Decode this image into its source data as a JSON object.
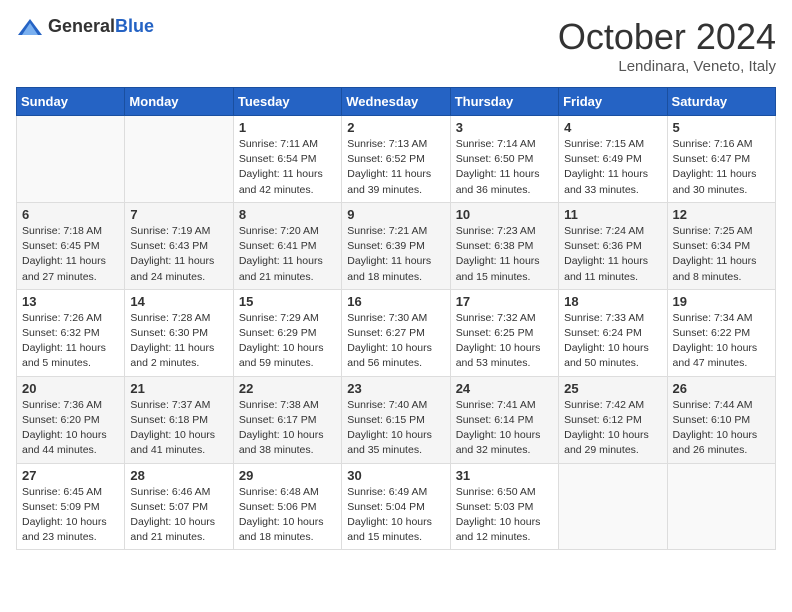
{
  "header": {
    "logo_general": "General",
    "logo_blue": "Blue",
    "title": "October 2024",
    "location": "Lendinara, Veneto, Italy"
  },
  "days_of_week": [
    "Sunday",
    "Monday",
    "Tuesday",
    "Wednesday",
    "Thursday",
    "Friday",
    "Saturday"
  ],
  "weeks": [
    [
      {
        "day": "",
        "info": ""
      },
      {
        "day": "",
        "info": ""
      },
      {
        "day": "1",
        "info": "Sunrise: 7:11 AM\nSunset: 6:54 PM\nDaylight: 11 hours and 42 minutes."
      },
      {
        "day": "2",
        "info": "Sunrise: 7:13 AM\nSunset: 6:52 PM\nDaylight: 11 hours and 39 minutes."
      },
      {
        "day": "3",
        "info": "Sunrise: 7:14 AM\nSunset: 6:50 PM\nDaylight: 11 hours and 36 minutes."
      },
      {
        "day": "4",
        "info": "Sunrise: 7:15 AM\nSunset: 6:49 PM\nDaylight: 11 hours and 33 minutes."
      },
      {
        "day": "5",
        "info": "Sunrise: 7:16 AM\nSunset: 6:47 PM\nDaylight: 11 hours and 30 minutes."
      }
    ],
    [
      {
        "day": "6",
        "info": "Sunrise: 7:18 AM\nSunset: 6:45 PM\nDaylight: 11 hours and 27 minutes."
      },
      {
        "day": "7",
        "info": "Sunrise: 7:19 AM\nSunset: 6:43 PM\nDaylight: 11 hours and 24 minutes."
      },
      {
        "day": "8",
        "info": "Sunrise: 7:20 AM\nSunset: 6:41 PM\nDaylight: 11 hours and 21 minutes."
      },
      {
        "day": "9",
        "info": "Sunrise: 7:21 AM\nSunset: 6:39 PM\nDaylight: 11 hours and 18 minutes."
      },
      {
        "day": "10",
        "info": "Sunrise: 7:23 AM\nSunset: 6:38 PM\nDaylight: 11 hours and 15 minutes."
      },
      {
        "day": "11",
        "info": "Sunrise: 7:24 AM\nSunset: 6:36 PM\nDaylight: 11 hours and 11 minutes."
      },
      {
        "day": "12",
        "info": "Sunrise: 7:25 AM\nSunset: 6:34 PM\nDaylight: 11 hours and 8 minutes."
      }
    ],
    [
      {
        "day": "13",
        "info": "Sunrise: 7:26 AM\nSunset: 6:32 PM\nDaylight: 11 hours and 5 minutes."
      },
      {
        "day": "14",
        "info": "Sunrise: 7:28 AM\nSunset: 6:30 PM\nDaylight: 11 hours and 2 minutes."
      },
      {
        "day": "15",
        "info": "Sunrise: 7:29 AM\nSunset: 6:29 PM\nDaylight: 10 hours and 59 minutes."
      },
      {
        "day": "16",
        "info": "Sunrise: 7:30 AM\nSunset: 6:27 PM\nDaylight: 10 hours and 56 minutes."
      },
      {
        "day": "17",
        "info": "Sunrise: 7:32 AM\nSunset: 6:25 PM\nDaylight: 10 hours and 53 minutes."
      },
      {
        "day": "18",
        "info": "Sunrise: 7:33 AM\nSunset: 6:24 PM\nDaylight: 10 hours and 50 minutes."
      },
      {
        "day": "19",
        "info": "Sunrise: 7:34 AM\nSunset: 6:22 PM\nDaylight: 10 hours and 47 minutes."
      }
    ],
    [
      {
        "day": "20",
        "info": "Sunrise: 7:36 AM\nSunset: 6:20 PM\nDaylight: 10 hours and 44 minutes."
      },
      {
        "day": "21",
        "info": "Sunrise: 7:37 AM\nSunset: 6:18 PM\nDaylight: 10 hours and 41 minutes."
      },
      {
        "day": "22",
        "info": "Sunrise: 7:38 AM\nSunset: 6:17 PM\nDaylight: 10 hours and 38 minutes."
      },
      {
        "day": "23",
        "info": "Sunrise: 7:40 AM\nSunset: 6:15 PM\nDaylight: 10 hours and 35 minutes."
      },
      {
        "day": "24",
        "info": "Sunrise: 7:41 AM\nSunset: 6:14 PM\nDaylight: 10 hours and 32 minutes."
      },
      {
        "day": "25",
        "info": "Sunrise: 7:42 AM\nSunset: 6:12 PM\nDaylight: 10 hours and 29 minutes."
      },
      {
        "day": "26",
        "info": "Sunrise: 7:44 AM\nSunset: 6:10 PM\nDaylight: 10 hours and 26 minutes."
      }
    ],
    [
      {
        "day": "27",
        "info": "Sunrise: 6:45 AM\nSunset: 5:09 PM\nDaylight: 10 hours and 23 minutes."
      },
      {
        "day": "28",
        "info": "Sunrise: 6:46 AM\nSunset: 5:07 PM\nDaylight: 10 hours and 21 minutes."
      },
      {
        "day": "29",
        "info": "Sunrise: 6:48 AM\nSunset: 5:06 PM\nDaylight: 10 hours and 18 minutes."
      },
      {
        "day": "30",
        "info": "Sunrise: 6:49 AM\nSunset: 5:04 PM\nDaylight: 10 hours and 15 minutes."
      },
      {
        "day": "31",
        "info": "Sunrise: 6:50 AM\nSunset: 5:03 PM\nDaylight: 10 hours and 12 minutes."
      },
      {
        "day": "",
        "info": ""
      },
      {
        "day": "",
        "info": ""
      }
    ]
  ]
}
